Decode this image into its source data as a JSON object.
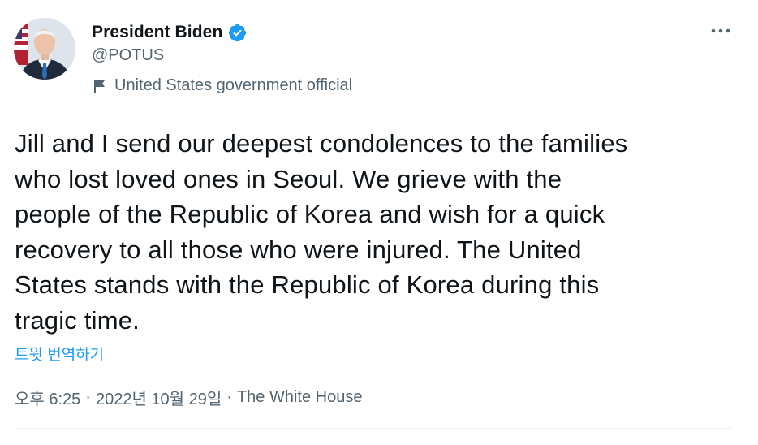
{
  "author": {
    "display_name": "President Biden",
    "handle": "@POTUS",
    "verified": true,
    "label": "United States government official"
  },
  "icons": {
    "verified": "verified-badge-icon",
    "label": "flag-icon",
    "more": "more-options-icon"
  },
  "colors": {
    "verified": "#1d9bf0",
    "link": "#1d9bf0",
    "secondary_text": "#536471",
    "primary_text": "#0f1419"
  },
  "tweet": {
    "text": "Jill and I send our deepest condolences to the families\nwho lost loved ones in Seoul. We grieve with the\npeople of the Republic of Korea and wish for a quick\nrecovery to all those who were injured. The United\nStates stands with the Republic of Korea during this\ntragic time.",
    "translate_label": "트윗 번역하기",
    "time": "오후 6:25",
    "separator": "·",
    "date": "2022년 10월 29일",
    "source": "The White House"
  }
}
